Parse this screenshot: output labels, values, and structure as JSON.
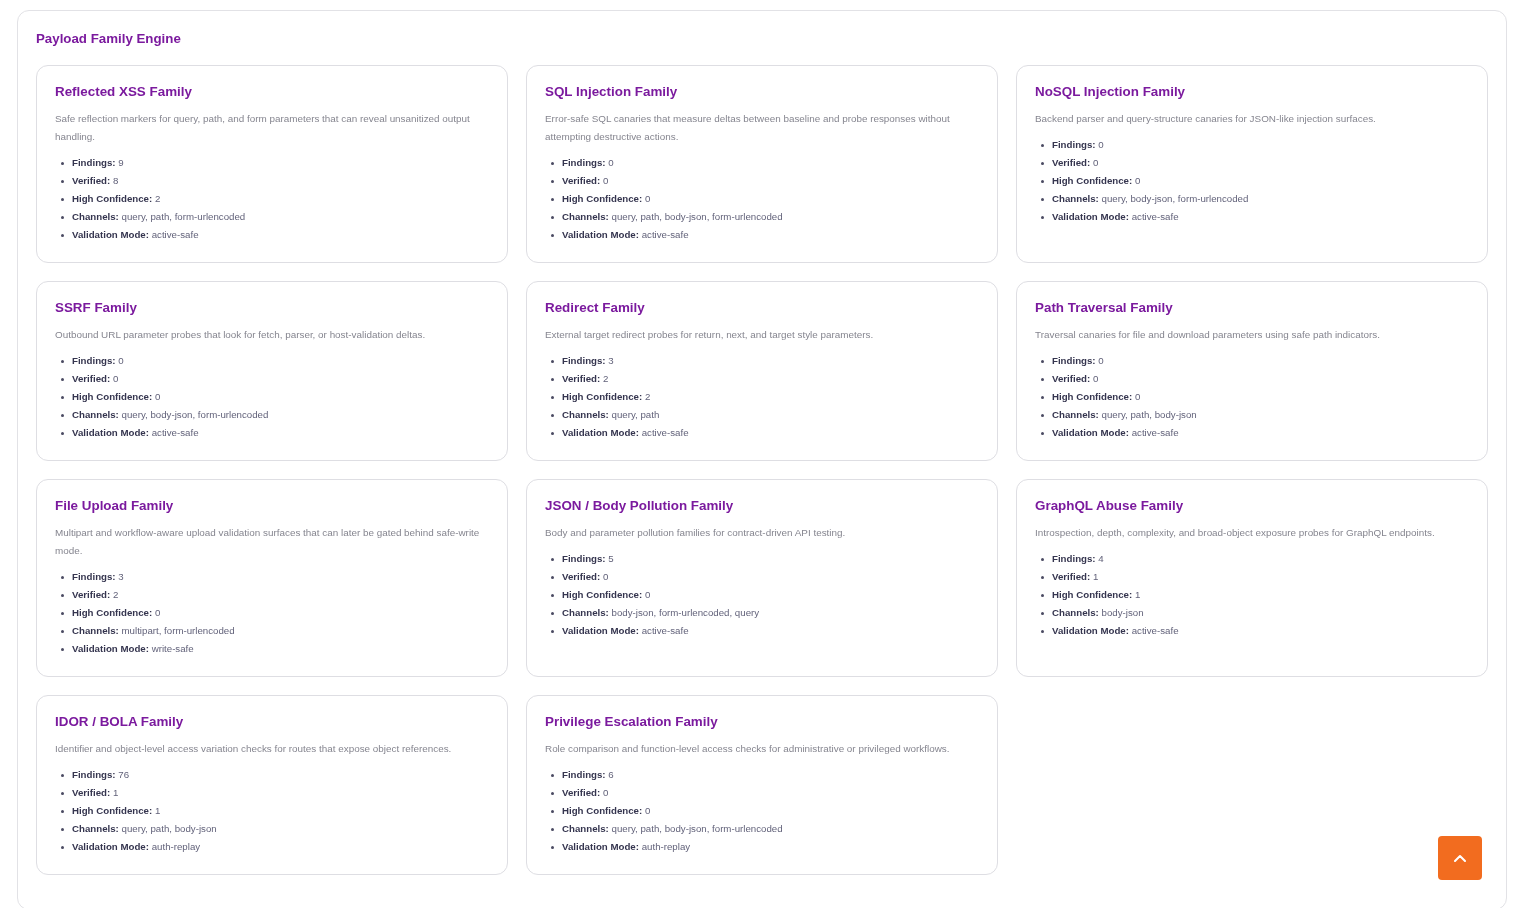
{
  "section": {
    "title": "Payload Family Engine"
  },
  "families": [
    {
      "name": "Reflected XSS Family",
      "description": "Safe reflection markers for query, path, and form parameters that can reveal unsanitized output handling.",
      "stats": [
        {
          "label": "Findings:",
          "value": "9"
        },
        {
          "label": "Verified:",
          "value": "8"
        },
        {
          "label": "High Confidence:",
          "value": "2"
        },
        {
          "label": "Channels:",
          "value": "query, path, form-urlencoded"
        },
        {
          "label": "Validation Mode:",
          "value": "active-safe"
        }
      ]
    },
    {
      "name": "SQL Injection Family",
      "description": "Error-safe SQL canaries that measure deltas between baseline and probe responses without attempting destructive actions.",
      "stats": [
        {
          "label": "Findings:",
          "value": "0"
        },
        {
          "label": "Verified:",
          "value": "0"
        },
        {
          "label": "High Confidence:",
          "value": "0"
        },
        {
          "label": "Channels:",
          "value": "query, path, body-json, form-urlencoded"
        },
        {
          "label": "Validation Mode:",
          "value": "active-safe"
        }
      ]
    },
    {
      "name": "NoSQL Injection Family",
      "description": "Backend parser and query-structure canaries for JSON-like injection surfaces.",
      "stats": [
        {
          "label": "Findings:",
          "value": "0"
        },
        {
          "label": "Verified:",
          "value": "0"
        },
        {
          "label": "High Confidence:",
          "value": "0"
        },
        {
          "label": "Channels:",
          "value": "query, body-json, form-urlencoded"
        },
        {
          "label": "Validation Mode:",
          "value": "active-safe"
        }
      ]
    },
    {
      "name": "SSRF Family",
      "description": "Outbound URL parameter probes that look for fetch, parser, or host-validation deltas.",
      "stats": [
        {
          "label": "Findings:",
          "value": "0"
        },
        {
          "label": "Verified:",
          "value": "0"
        },
        {
          "label": "High Confidence:",
          "value": "0"
        },
        {
          "label": "Channels:",
          "value": "query, body-json, form-urlencoded"
        },
        {
          "label": "Validation Mode:",
          "value": "active-safe"
        }
      ]
    },
    {
      "name": "Redirect Family",
      "description": "External target redirect probes for return, next, and target style parameters.",
      "stats": [
        {
          "label": "Findings:",
          "value": "3"
        },
        {
          "label": "Verified:",
          "value": "2"
        },
        {
          "label": "High Confidence:",
          "value": "2"
        },
        {
          "label": "Channels:",
          "value": "query, path"
        },
        {
          "label": "Validation Mode:",
          "value": "active-safe"
        }
      ]
    },
    {
      "name": "Path Traversal Family",
      "description": "Traversal canaries for file and download parameters using safe path indicators.",
      "stats": [
        {
          "label": "Findings:",
          "value": "0"
        },
        {
          "label": "Verified:",
          "value": "0"
        },
        {
          "label": "High Confidence:",
          "value": "0"
        },
        {
          "label": "Channels:",
          "value": "query, path, body-json"
        },
        {
          "label": "Validation Mode:",
          "value": "active-safe"
        }
      ]
    },
    {
      "name": "File Upload Family",
      "description": "Multipart and workflow-aware upload validation surfaces that can later be gated behind safe-write mode.",
      "stats": [
        {
          "label": "Findings:",
          "value": "3"
        },
        {
          "label": "Verified:",
          "value": "2"
        },
        {
          "label": "High Confidence:",
          "value": "0"
        },
        {
          "label": "Channels:",
          "value": "multipart, form-urlencoded"
        },
        {
          "label": "Validation Mode:",
          "value": "write-safe"
        }
      ]
    },
    {
      "name": "JSON / Body Pollution Family",
      "description": "Body and parameter pollution families for contract-driven API testing.",
      "stats": [
        {
          "label": "Findings:",
          "value": "5"
        },
        {
          "label": "Verified:",
          "value": "0"
        },
        {
          "label": "High Confidence:",
          "value": "0"
        },
        {
          "label": "Channels:",
          "value": "body-json, form-urlencoded, query"
        },
        {
          "label": "Validation Mode:",
          "value": "active-safe"
        }
      ]
    },
    {
      "name": "GraphQL Abuse Family",
      "description": "Introspection, depth, complexity, and broad-object exposure probes for GraphQL endpoints.",
      "stats": [
        {
          "label": "Findings:",
          "value": "4"
        },
        {
          "label": "Verified:",
          "value": "1"
        },
        {
          "label": "High Confidence:",
          "value": "1"
        },
        {
          "label": "Channels:",
          "value": "body-json"
        },
        {
          "label": "Validation Mode:",
          "value": "active-safe"
        }
      ]
    },
    {
      "name": "IDOR / BOLA Family",
      "description": "Identifier and object-level access variation checks for routes that expose object references.",
      "stats": [
        {
          "label": "Findings:",
          "value": "76"
        },
        {
          "label": "Verified:",
          "value": "1"
        },
        {
          "label": "High Confidence:",
          "value": "1"
        },
        {
          "label": "Channels:",
          "value": "query, path, body-json"
        },
        {
          "label": "Validation Mode:",
          "value": "auth-replay"
        }
      ]
    },
    {
      "name": "Privilege Escalation Family",
      "description": "Role comparison and function-level access checks for administrative or privileged workflows.",
      "stats": [
        {
          "label": "Findings:",
          "value": "6"
        },
        {
          "label": "Verified:",
          "value": "0"
        },
        {
          "label": "High Confidence:",
          "value": "0"
        },
        {
          "label": "Channels:",
          "value": "query, path, body-json, form-urlencoded"
        },
        {
          "label": "Validation Mode:",
          "value": "auth-replay"
        }
      ]
    }
  ]
}
